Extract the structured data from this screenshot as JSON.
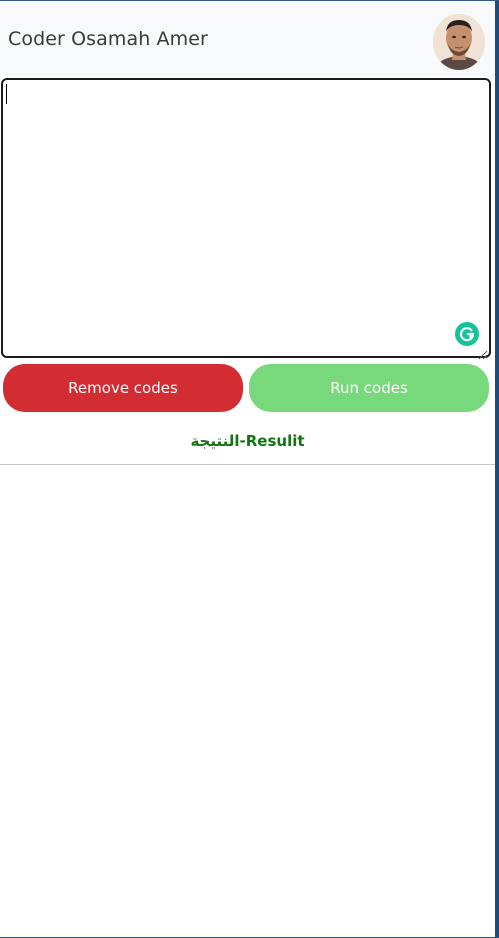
{
  "navbar": {
    "brand": "Coder Osamah Amer"
  },
  "editor": {
    "value": "",
    "placeholder": ""
  },
  "buttons": {
    "remove_label": "Remove codes",
    "run_label": "Run codes"
  },
  "result": {
    "label": "النتيجة-Resulit"
  },
  "icons": {
    "avatar": "user-avatar-photo",
    "grammarly": "grammarly-icon",
    "resize": "resize-grip-icon"
  },
  "colors": {
    "remove_button": "#d12d32",
    "run_button": "#78d87c",
    "result_label": "#127412",
    "navbar_bg": "#f8f9fa",
    "grammarly": "#15c39a"
  }
}
